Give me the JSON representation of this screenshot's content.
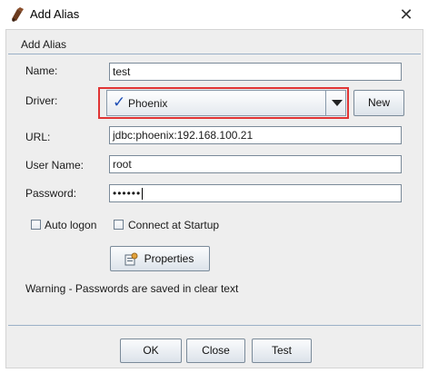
{
  "window": {
    "title": "Add Alias"
  },
  "section_title": "Add Alias",
  "fields": {
    "name": {
      "label": "Name:",
      "value": "test"
    },
    "driver": {
      "label": "Driver:",
      "value": "Phoenix"
    },
    "url": {
      "label": "URL:",
      "value": "jdbc:phoenix:192.168.100.21"
    },
    "user_name": {
      "label": "User Name:",
      "value": "root"
    },
    "password": {
      "label": "Password:",
      "value": "••••••"
    }
  },
  "buttons": {
    "new": "New",
    "properties": "Properties",
    "ok": "OK",
    "close": "Close",
    "test": "Test"
  },
  "checkboxes": {
    "auto_logon": {
      "label": "Auto logon",
      "checked": false
    },
    "connect_at_startup": {
      "label": "Connect at Startup",
      "checked": false
    }
  },
  "warning": "Warning - Passwords are saved in clear text",
  "colors": {
    "highlight": "#e03434",
    "check": "#1f4fb5"
  },
  "icons": [
    "app-icon",
    "close-icon",
    "check-icon",
    "dropdown-arrow-icon",
    "properties-icon"
  ]
}
